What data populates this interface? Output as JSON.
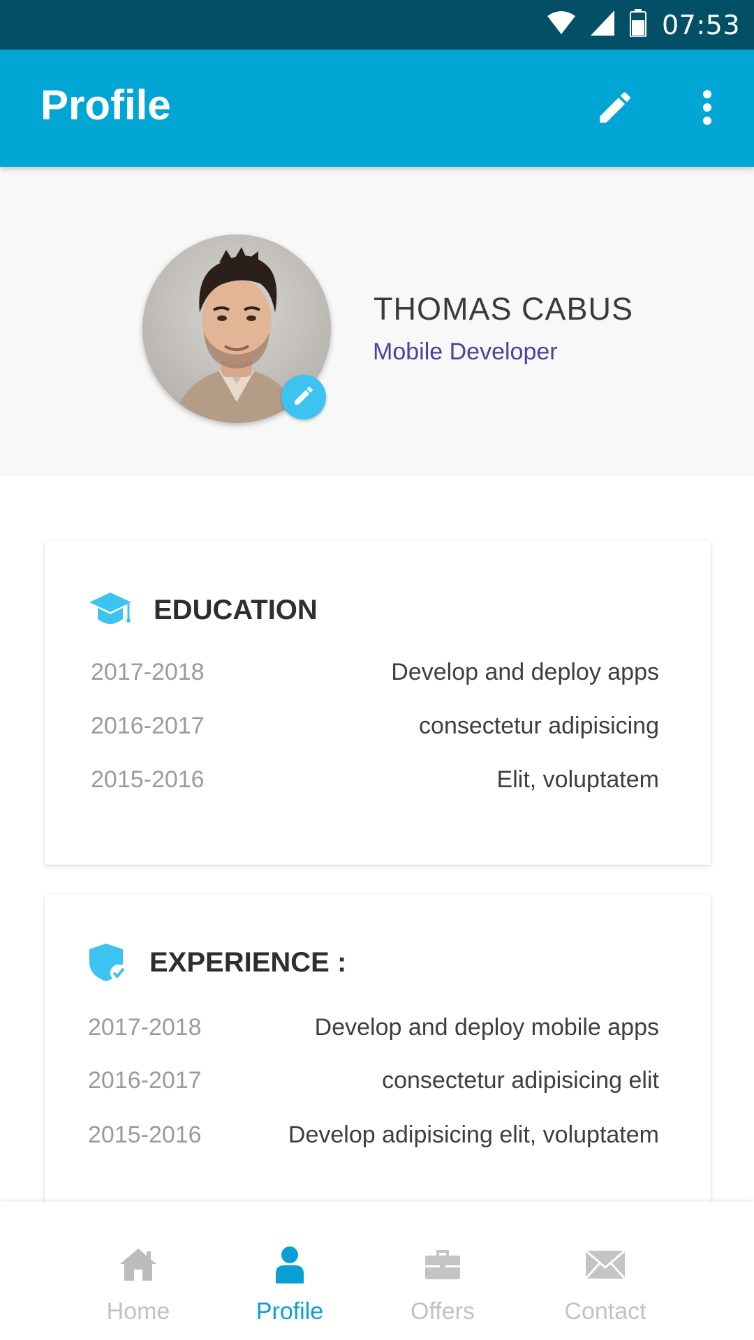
{
  "status_bar": {
    "time": "07:53",
    "icons": [
      "wifi-icon",
      "signal-icon",
      "battery-icon"
    ]
  },
  "app_bar": {
    "title": "Profile",
    "actions": [
      "edit-icon",
      "more-vert-icon"
    ],
    "color": "#02a6d4"
  },
  "profile": {
    "name": "THOMAS CABUS",
    "role": "Mobile Developer",
    "avatar_edit_icon": "pencil-icon"
  },
  "education": {
    "title": "EDUCATION",
    "icon": "graduation-cap-icon",
    "rows": [
      {
        "year": "2017-2018",
        "desc": "Develop and deploy apps"
      },
      {
        "year": "2016-2017",
        "desc": "consectetur adipisicing"
      },
      {
        "year": "2015-2016",
        "desc": "Elit, voluptatem"
      }
    ]
  },
  "experience": {
    "title": "EXPERIENCE :",
    "icon": "shield-check-icon",
    "rows": [
      {
        "year": "2017-2018",
        "desc": "Develop and deploy mobile apps"
      },
      {
        "year": "2016-2017",
        "desc": "consectetur adipisicing elit"
      },
      {
        "year": "2015-2016",
        "desc": "Develop adipisicing elit, voluptatem"
      }
    ]
  },
  "bottom_nav": {
    "items": [
      {
        "label": "Home",
        "icon": "home-icon",
        "active": false
      },
      {
        "label": "Profile",
        "icon": "person-icon",
        "active": true
      },
      {
        "label": "Offers",
        "icon": "briefcase-icon",
        "active": false
      },
      {
        "label": "Contact",
        "icon": "envelope-icon",
        "active": false
      }
    ],
    "active_color": "#08a0d4",
    "inactive_color": "#c2c2c2"
  }
}
